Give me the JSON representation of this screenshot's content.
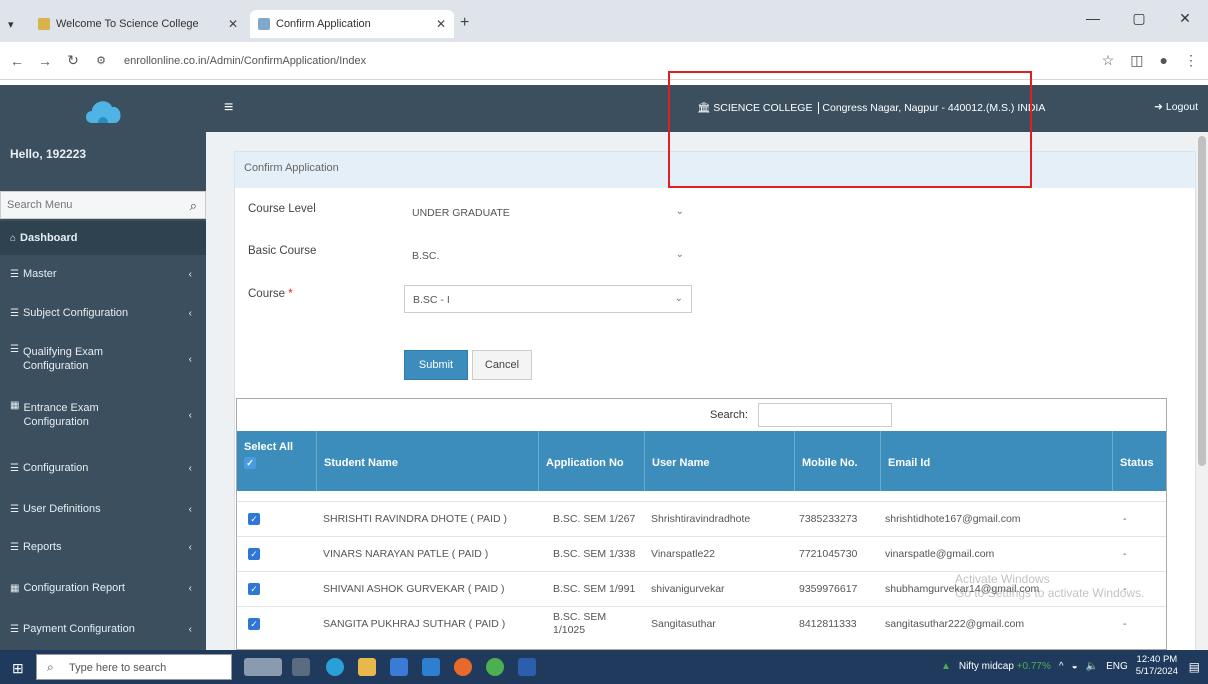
{
  "browser": {
    "tabs": [
      {
        "title": "Welcome To Science College",
        "active": false
      },
      {
        "title": "Confirm Application",
        "active": true
      }
    ],
    "url": "enrollonline.co.in/Admin/ConfirmApplication/Index",
    "win_controls": [
      "—",
      "▢",
      "✕"
    ]
  },
  "sidebar": {
    "hello": "Hello, 192223",
    "search_placeholder": "Search Menu",
    "items": [
      {
        "label": "Dashboard",
        "icon": "dashboard-icon"
      },
      {
        "label": "Master",
        "icon": "list-icon"
      },
      {
        "label": "Subject Configuration",
        "icon": "list-icon"
      },
      {
        "label": "Qualifying Exam Configuration",
        "icon": "list-icon"
      },
      {
        "label": "Entrance Exam Configuration",
        "icon": "table-icon"
      },
      {
        "label": "Configuration",
        "icon": "list-icon"
      },
      {
        "label": "User Definitions",
        "icon": "list-icon"
      },
      {
        "label": "Reports",
        "icon": "list-icon"
      },
      {
        "label": "Configuration Report",
        "icon": "table-icon"
      },
      {
        "label": "Payment Configuration",
        "icon": "list-icon"
      }
    ]
  },
  "header": {
    "college": "SCIENCE COLLEGE",
    "address": "Congress Nagar, Nagpur - 440012.(M.S.) INDIA",
    "logout": "Logout"
  },
  "form": {
    "title": "Confirm Application",
    "course_level_label": "Course Level",
    "course_level_value": "UNDER GRADUATE",
    "basic_course_label": "Basic Course",
    "basic_course_value": "B.SC.",
    "course_label": "Course",
    "course_value": "B.SC - I",
    "submit": "Submit",
    "cancel": "Cancel"
  },
  "table": {
    "search_label": "Search:",
    "select_all": "Select All",
    "columns": [
      "Student Name",
      "Application No",
      "User Name",
      "Mobile No.",
      "Email Id",
      "Status"
    ],
    "rows": [
      {
        "name": "SHRISHTI RAVINDRA DHOTE ( PAID )",
        "app_no": "B.SC. SEM 1/267",
        "user": "Shrishtiravindradhote",
        "mobile": "7385233273",
        "email": "shrishtidhote167@gmail.com",
        "status": "-"
      },
      {
        "name": "VINARS NARAYAN PATLE ( PAID )",
        "app_no": "B.SC. SEM 1/338",
        "user": "Vinarspatle22",
        "mobile": "7721045730",
        "email": "vinarspatle@gmail.com",
        "status": "-"
      },
      {
        "name": "SHIVANI ASHOK GURVEKAR ( PAID )",
        "app_no": "B.SC. SEM 1/991",
        "user": "shivanigurvekar",
        "mobile": "9359976617",
        "email": "shubhamgurvekar14@gmail.com",
        "status": "-"
      },
      {
        "name": "SANGITA PUKHRAJ SUTHAR ( PAID )",
        "app_no": "B.SC. SEM 1/1025",
        "user": "Sangitasuthar",
        "mobile": "8412811333",
        "email": "sangitasuthar222@gmail.com",
        "status": "-"
      }
    ]
  },
  "watermark": {
    "line1": "Activate Windows",
    "line2": "Go to Settings to activate Windows."
  },
  "taskbar": {
    "search_placeholder": "Type here to search",
    "market": "Nifty midcap",
    "market_change": "+0.77%",
    "lang": "ENG",
    "time": "12:40 PM",
    "date": "5/17/2024"
  }
}
